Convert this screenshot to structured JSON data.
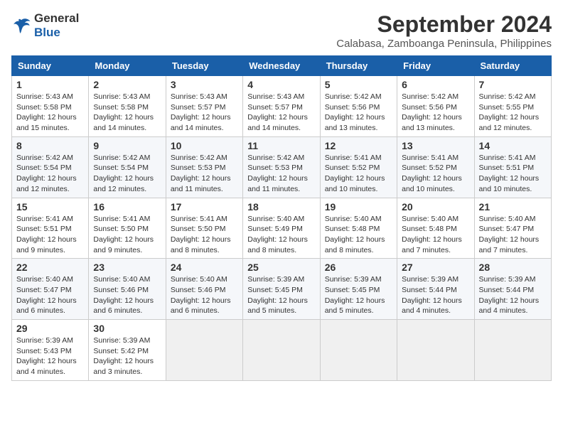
{
  "header": {
    "logo_line1": "General",
    "logo_line2": "Blue",
    "month": "September 2024",
    "location": "Calabasa, Zamboanga Peninsula, Philippines"
  },
  "weekdays": [
    "Sunday",
    "Monday",
    "Tuesday",
    "Wednesday",
    "Thursday",
    "Friday",
    "Saturday"
  ],
  "weeks": [
    [
      {
        "day": "1",
        "sunrise": "5:43 AM",
        "sunset": "5:58 PM",
        "daylight": "12 hours and 15 minutes."
      },
      {
        "day": "2",
        "sunrise": "5:43 AM",
        "sunset": "5:58 PM",
        "daylight": "12 hours and 14 minutes."
      },
      {
        "day": "3",
        "sunrise": "5:43 AM",
        "sunset": "5:57 PM",
        "daylight": "12 hours and 14 minutes."
      },
      {
        "day": "4",
        "sunrise": "5:43 AM",
        "sunset": "5:57 PM",
        "daylight": "12 hours and 14 minutes."
      },
      {
        "day": "5",
        "sunrise": "5:42 AM",
        "sunset": "5:56 PM",
        "daylight": "12 hours and 13 minutes."
      },
      {
        "day": "6",
        "sunrise": "5:42 AM",
        "sunset": "5:56 PM",
        "daylight": "12 hours and 13 minutes."
      },
      {
        "day": "7",
        "sunrise": "5:42 AM",
        "sunset": "5:55 PM",
        "daylight": "12 hours and 12 minutes."
      }
    ],
    [
      {
        "day": "8",
        "sunrise": "5:42 AM",
        "sunset": "5:54 PM",
        "daylight": "12 hours and 12 minutes."
      },
      {
        "day": "9",
        "sunrise": "5:42 AM",
        "sunset": "5:54 PM",
        "daylight": "12 hours and 12 minutes."
      },
      {
        "day": "10",
        "sunrise": "5:42 AM",
        "sunset": "5:53 PM",
        "daylight": "12 hours and 11 minutes."
      },
      {
        "day": "11",
        "sunrise": "5:42 AM",
        "sunset": "5:53 PM",
        "daylight": "12 hours and 11 minutes."
      },
      {
        "day": "12",
        "sunrise": "5:41 AM",
        "sunset": "5:52 PM",
        "daylight": "12 hours and 10 minutes."
      },
      {
        "day": "13",
        "sunrise": "5:41 AM",
        "sunset": "5:52 PM",
        "daylight": "12 hours and 10 minutes."
      },
      {
        "day": "14",
        "sunrise": "5:41 AM",
        "sunset": "5:51 PM",
        "daylight": "12 hours and 10 minutes."
      }
    ],
    [
      {
        "day": "15",
        "sunrise": "5:41 AM",
        "sunset": "5:51 PM",
        "daylight": "12 hours and 9 minutes."
      },
      {
        "day": "16",
        "sunrise": "5:41 AM",
        "sunset": "5:50 PM",
        "daylight": "12 hours and 9 minutes."
      },
      {
        "day": "17",
        "sunrise": "5:41 AM",
        "sunset": "5:50 PM",
        "daylight": "12 hours and 8 minutes."
      },
      {
        "day": "18",
        "sunrise": "5:40 AM",
        "sunset": "5:49 PM",
        "daylight": "12 hours and 8 minutes."
      },
      {
        "day": "19",
        "sunrise": "5:40 AM",
        "sunset": "5:48 PM",
        "daylight": "12 hours and 8 minutes."
      },
      {
        "day": "20",
        "sunrise": "5:40 AM",
        "sunset": "5:48 PM",
        "daylight": "12 hours and 7 minutes."
      },
      {
        "day": "21",
        "sunrise": "5:40 AM",
        "sunset": "5:47 PM",
        "daylight": "12 hours and 7 minutes."
      }
    ],
    [
      {
        "day": "22",
        "sunrise": "5:40 AM",
        "sunset": "5:47 PM",
        "daylight": "12 hours and 6 minutes."
      },
      {
        "day": "23",
        "sunrise": "5:40 AM",
        "sunset": "5:46 PM",
        "daylight": "12 hours and 6 minutes."
      },
      {
        "day": "24",
        "sunrise": "5:40 AM",
        "sunset": "5:46 PM",
        "daylight": "12 hours and 6 minutes."
      },
      {
        "day": "25",
        "sunrise": "5:39 AM",
        "sunset": "5:45 PM",
        "daylight": "12 hours and 5 minutes."
      },
      {
        "day": "26",
        "sunrise": "5:39 AM",
        "sunset": "5:45 PM",
        "daylight": "12 hours and 5 minutes."
      },
      {
        "day": "27",
        "sunrise": "5:39 AM",
        "sunset": "5:44 PM",
        "daylight": "12 hours and 4 minutes."
      },
      {
        "day": "28",
        "sunrise": "5:39 AM",
        "sunset": "5:44 PM",
        "daylight": "12 hours and 4 minutes."
      }
    ],
    [
      {
        "day": "29",
        "sunrise": "5:39 AM",
        "sunset": "5:43 PM",
        "daylight": "12 hours and 4 minutes."
      },
      {
        "day": "30",
        "sunrise": "5:39 AM",
        "sunset": "5:42 PM",
        "daylight": "12 hours and 3 minutes."
      },
      null,
      null,
      null,
      null,
      null
    ]
  ]
}
